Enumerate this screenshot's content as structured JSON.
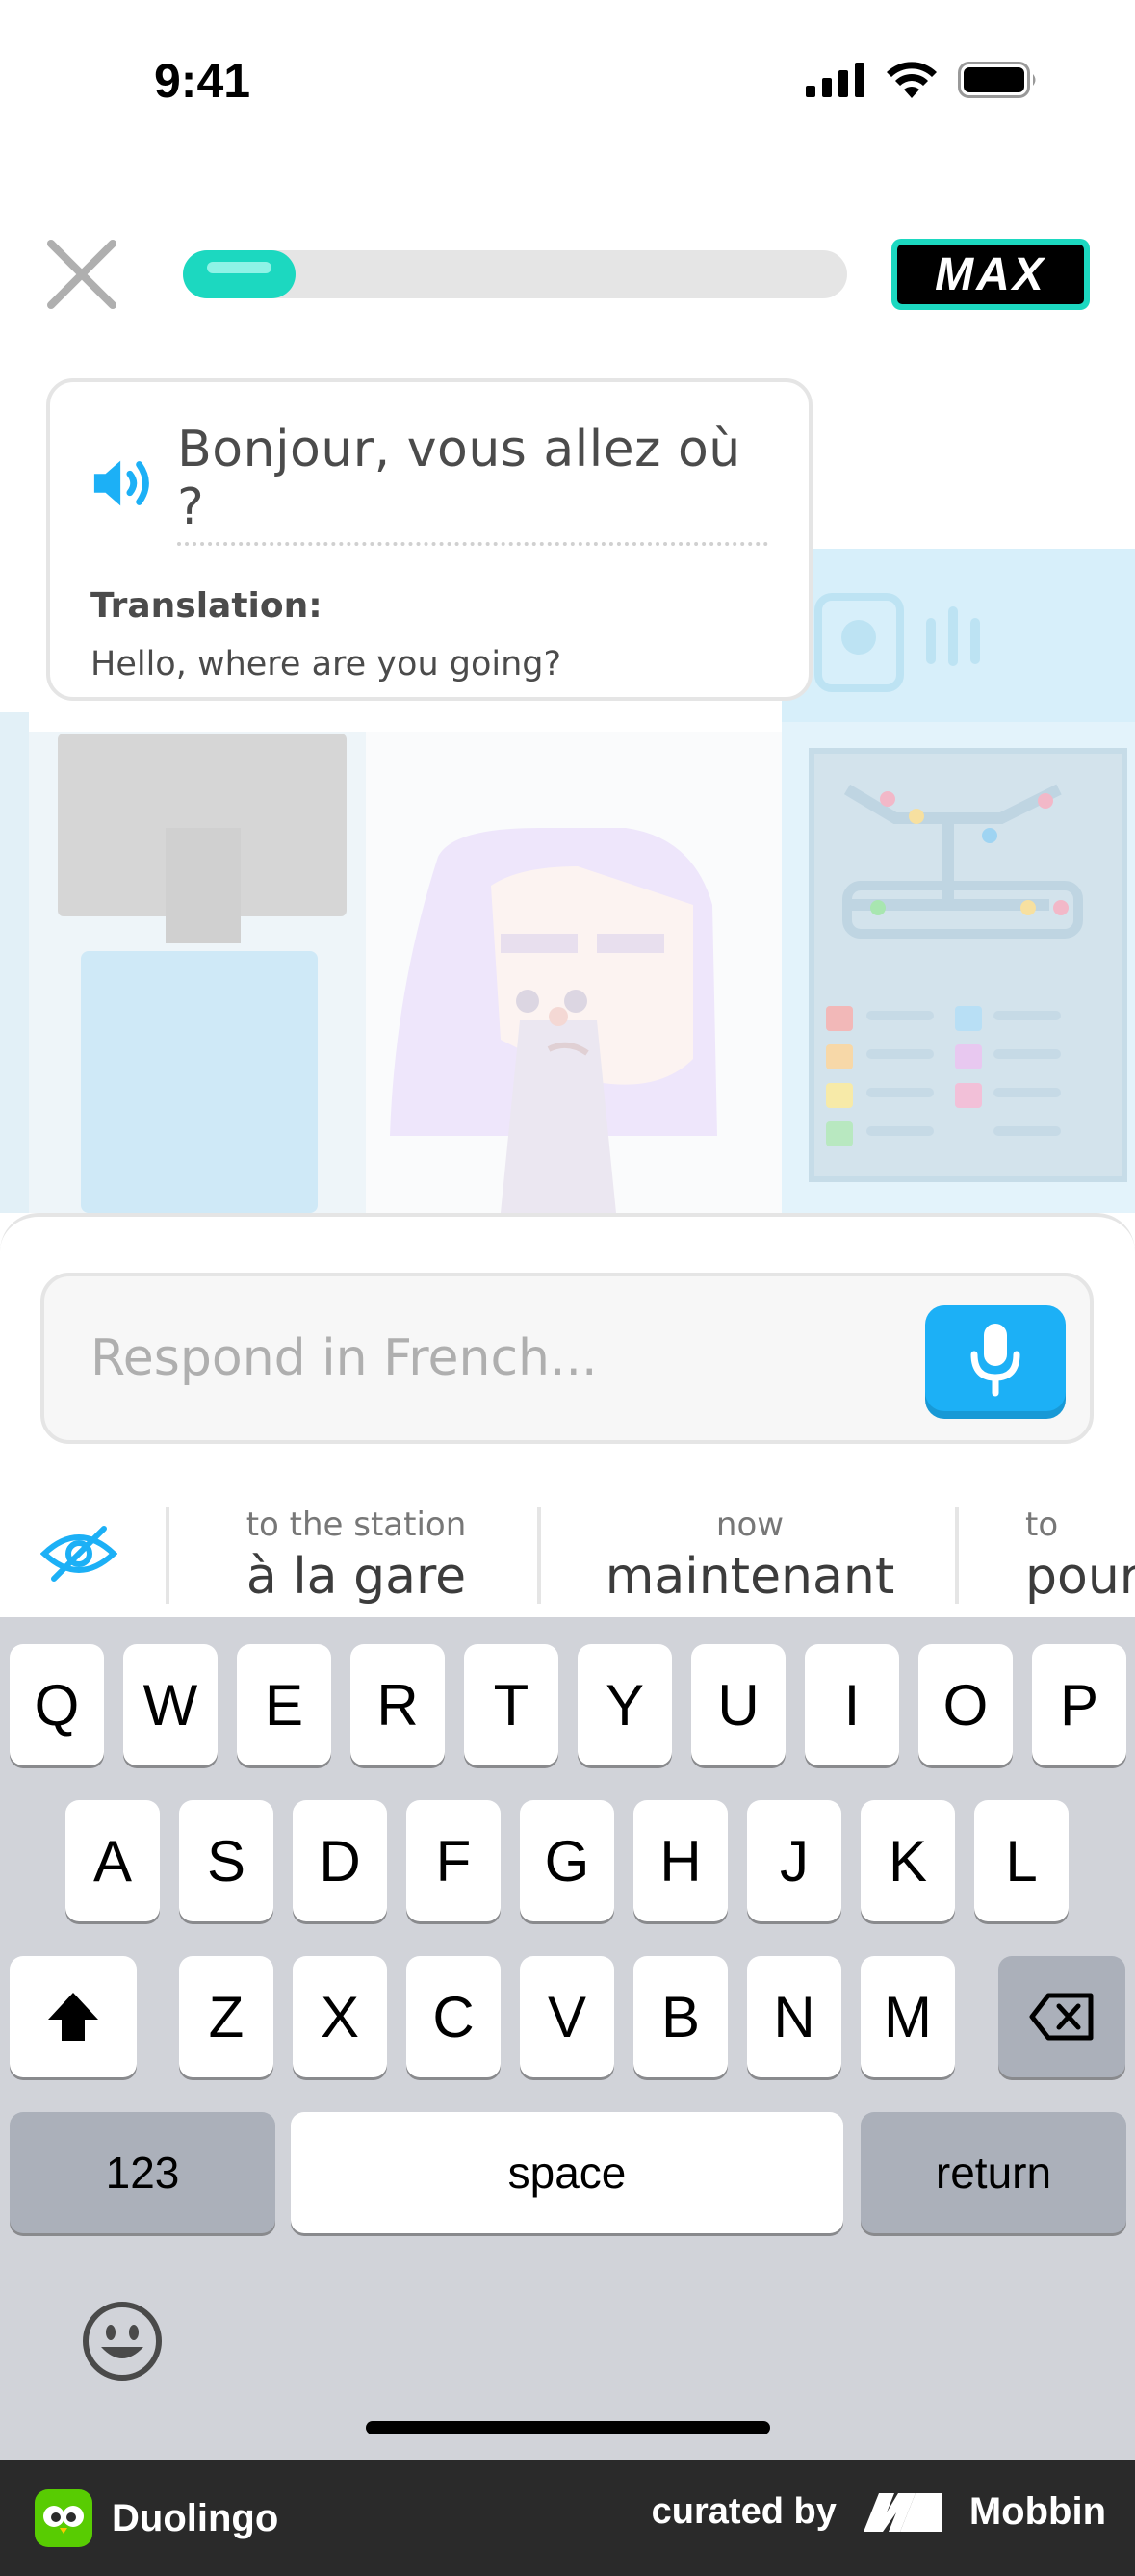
{
  "status_bar": {
    "time": "9:41"
  },
  "lesson": {
    "progress": 0.17,
    "badge_label": "MAX"
  },
  "prompt": {
    "phrase": "Bonjour, vous allez où ?",
    "translation_label": "Translation:",
    "translation_text": "Hello, where are you going?"
  },
  "response": {
    "placeholder": "Respond in French..."
  },
  "hints": [
    {
      "translation": "to the station",
      "french": "à la gare"
    },
    {
      "translation": "now",
      "french": "maintenant"
    },
    {
      "translation": "to",
      "french": "pour"
    }
  ],
  "keyboard": {
    "row1": [
      "Q",
      "W",
      "E",
      "R",
      "T",
      "Y",
      "U",
      "I",
      "O",
      "P"
    ],
    "row2": [
      "A",
      "S",
      "D",
      "F",
      "G",
      "H",
      "J",
      "K",
      "L"
    ],
    "row3": [
      "Z",
      "X",
      "C",
      "V",
      "B",
      "N",
      "M"
    ],
    "numbers_label": "123",
    "space_label": "space",
    "return_label": "return"
  },
  "footer": {
    "app_name": "Duolingo",
    "curated_by": "curated by",
    "brand": "Mobbin"
  },
  "colors": {
    "accent_blue": "#1cb0f6",
    "progress_teal": "#1cd8c0",
    "keyboard_bg": "#d1d3d9"
  }
}
